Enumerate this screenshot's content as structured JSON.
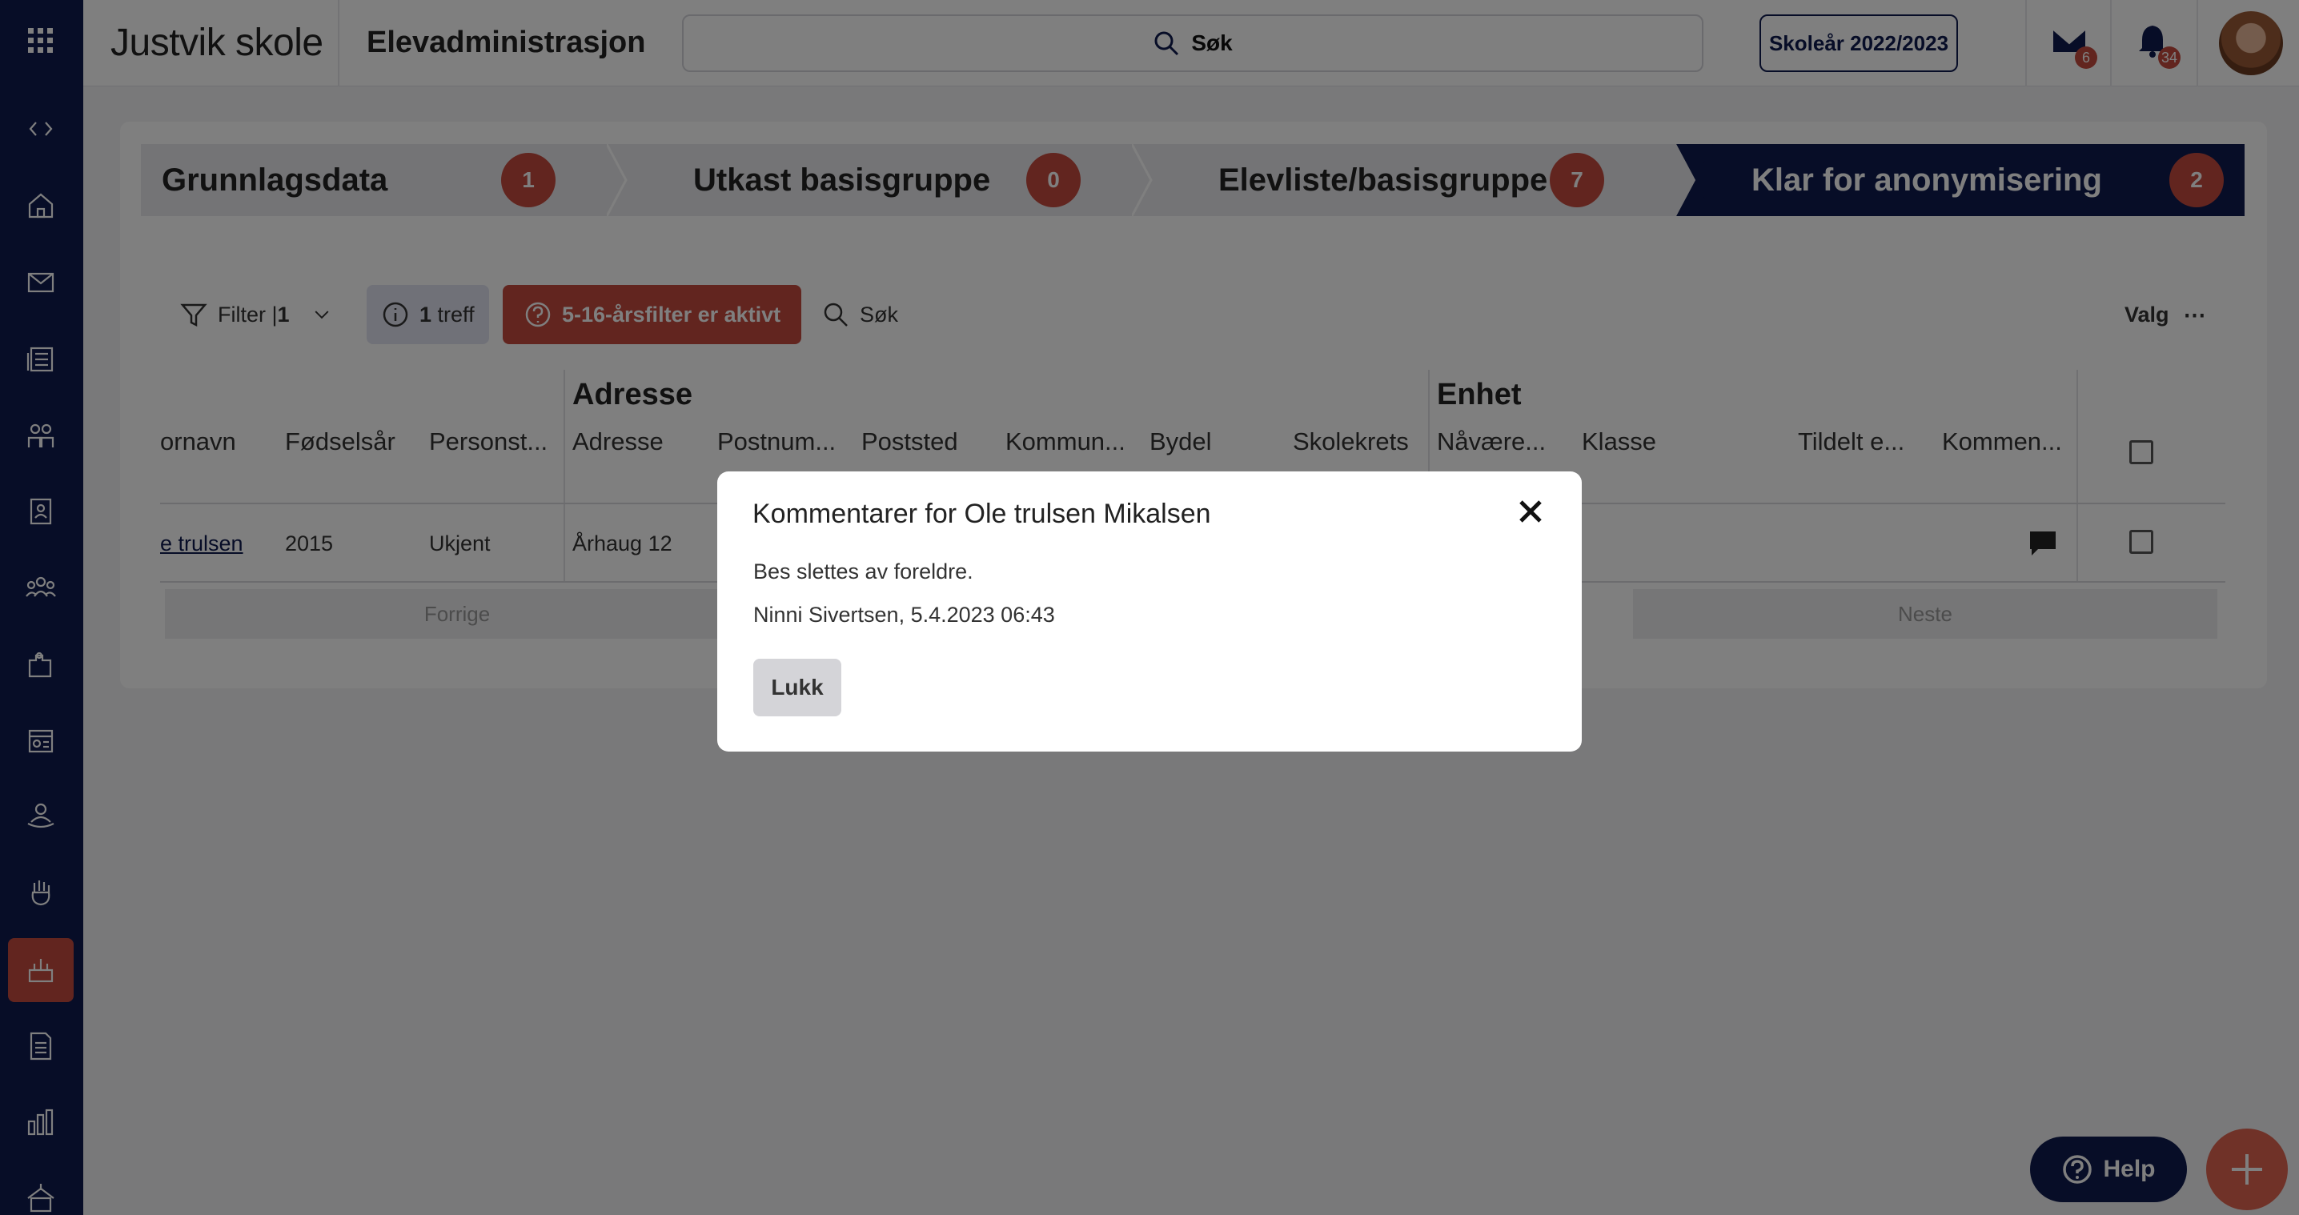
{
  "header": {
    "school_name": "Justvik skole",
    "app_title": "Elevadministrasjon",
    "search_label": "Søk",
    "school_year": "Skoleår 2022/2023",
    "mail_count": "6",
    "notification_count": "34"
  },
  "steps": [
    {
      "label": "Grunnlagsdata",
      "count": "1"
    },
    {
      "label": "Utkast basisgruppe",
      "count": "0"
    },
    {
      "label": "Elevliste/basisgruppe",
      "count": "7"
    },
    {
      "label": "Klar for anonymisering",
      "count": "2"
    }
  ],
  "toolbar": {
    "filter_label": "Filter |",
    "filter_count": "1",
    "hits_count": "1",
    "hits_label": "treff",
    "warning": "5-16-årsfilter er aktivt",
    "search_label": "Søk",
    "options_label": "Valg"
  },
  "table": {
    "groups": {
      "address": "Adresse",
      "unit": "Enhet"
    },
    "columns": [
      "ornavn",
      "Fødselsår",
      "Personst...",
      "Adresse",
      "Postnum...",
      "Poststed",
      "Kommun...",
      "Bydel",
      "Skolekrets",
      "Nåvære...",
      "Klasse",
      "Tildelt e...",
      "Kommen..."
    ],
    "row": {
      "name": "e trulsen",
      "birth_year": "2015",
      "status": "Ukjent",
      "address": "Århaug 12"
    },
    "pager": {
      "prev": "Forrige",
      "next": "Neste"
    }
  },
  "modal": {
    "title": "Kommentarer for Ole trulsen Mikalsen",
    "comment": "Bes slettes av foreldre.",
    "author_date": "Ninni Sivertsen, 5.4.2023 06:43",
    "close_button": "Lukk"
  },
  "floating": {
    "help_label": "Help"
  },
  "colors": {
    "navy": "#0f1a4e",
    "accent_red": "#c44a3e",
    "fab": "#e06450"
  }
}
